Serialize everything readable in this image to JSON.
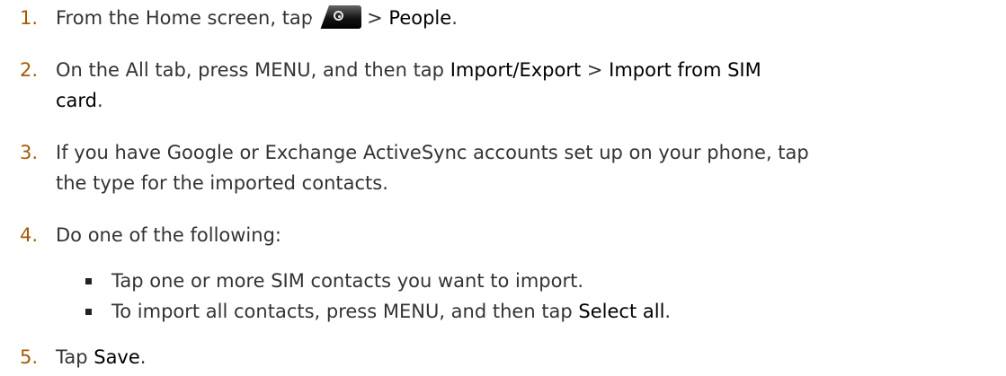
{
  "steps": [
    {
      "number": "1.",
      "pre": "From the Home screen, tap",
      "sep": "> ",
      "bold": "People",
      "post": "."
    },
    {
      "number": "2.",
      "line1_pre": "On the All tab, press MENU, and then tap ",
      "line1_bold": "Import/Export",
      "line1_sep": " > ",
      "line1_bold2": "Import from SIM",
      "line2_bold": "card",
      "line2_post": "."
    },
    {
      "number": "3.",
      "line1": "If you have Google or Exchange ActiveSync accounts set up on your phone, tap",
      "line2": "the type for the imported contacts."
    },
    {
      "number": "4.",
      "text": "Do one of the following:"
    },
    {
      "number": "5.",
      "pre": "Tap ",
      "bold": "Save",
      "post": "."
    }
  ],
  "bullets": [
    {
      "text": "Tap one or more SIM contacts you want to import."
    },
    {
      "pre": "To import all contacts, press MENU, and then tap ",
      "bold": "Select all",
      "post": "."
    }
  ],
  "icons": {
    "home_button": "all-apps-button-icon"
  },
  "colors": {
    "step_number": "#a65a05",
    "body_text": "#333333",
    "emphasis": "#000000"
  }
}
